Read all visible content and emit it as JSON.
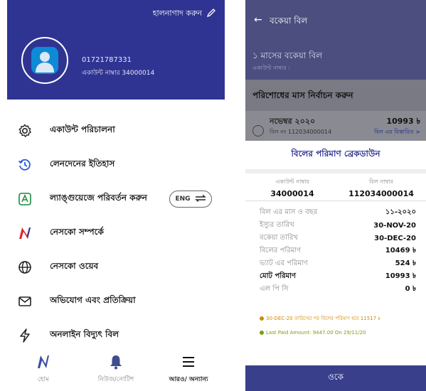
{
  "left_screen": {
    "header": {
      "edit_label": "হালনাগাদ করুন",
      "phone": "01721787331",
      "account": "একাউন্ট নাম্বার 34000014"
    },
    "menu": {
      "items": [
        {
          "label": "একাউন্ট পরিচালনা",
          "icon": "gear-icon"
        },
        {
          "label": "লেনদেনের ইতিহাস",
          "icon": "history-icon"
        },
        {
          "label": "ল্যাঙ্গুয়েজে পরিবর্তন করুন",
          "icon": "language-icon"
        },
        {
          "label": "নেসকো সম্পর্কে",
          "icon": "nesco-logo-icon"
        },
        {
          "label": "নেসকো ওয়েব",
          "icon": "globe-icon"
        },
        {
          "label": "অভিযোগ এবং প্রতিক্রিয়া",
          "icon": "mail-icon"
        },
        {
          "label": "অনলাইন বিদ্যুৎ বিল",
          "icon": "bolt-icon"
        }
      ],
      "lang_toggle": "ENG"
    },
    "bottom_nav": {
      "home": "হোম",
      "notice": "নিউজ/নোটিশ",
      "more": "আরও/ অন্যান্য"
    }
  },
  "right_screen": {
    "title": "বকেয়া বিল",
    "sub_title": "১ মাসের বকেয়া বিল",
    "sub_account": "একাউন্ট নাম্বার : ",
    "section_title": "পরিশোধের মাস নির্বাচন করুন",
    "month_row": {
      "month": "নভেম্বর ২০২০",
      "bill_no": "বিল নং 112034000014",
      "amount": "10993 ৳",
      "details_link": "বিল এর বিস্তারিত >"
    },
    "card": {
      "title": "বিলের পরিমাণ ব্রেকডাউন",
      "account_caption": "একাউন্ট নাম্বার",
      "account_value": "34000014",
      "bill_caption": "বিল নাম্বার",
      "bill_value": "112034000014",
      "rows": [
        {
          "label": "বিল এর মাস ও বছর",
          "value": "১১-২০২০"
        },
        {
          "label": "ইস্যুর তারিখ",
          "value": "30-NOV-20"
        },
        {
          "label": "বকেয়া তারিখ",
          "value": "30-DEC-20"
        },
        {
          "label": "বিলের পরিমাণ",
          "value": "10469 ৳"
        },
        {
          "label": "ভ্যাট এর পরিমাণ",
          "value": "524 ৳"
        },
        {
          "label": "মোট পরিমাণ",
          "value": "10993 ৳"
        },
        {
          "label": "এল পি সি",
          "value": "0 ৳"
        }
      ],
      "note_due": "30-DEC-20 তারিখের পর বিলের পরিমাণ হবে 11517 ৳",
      "note_last_paid": "Last Paid Amount: 9447.00 On 29/11/20"
    },
    "ok_label": "ওকে"
  },
  "colors": {
    "header_blue": "#2f3493",
    "ok_bar": "#3a3f8c",
    "note_orange": "#d18a00",
    "note_green": "#7a9e12"
  }
}
